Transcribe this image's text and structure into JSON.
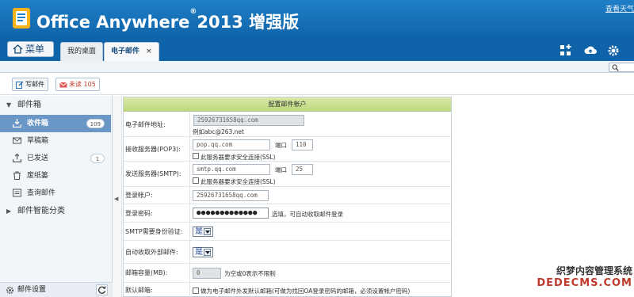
{
  "header": {
    "brand": "Office Anywhere",
    "registered": "®",
    "version": "2013 增强版",
    "weather_link": "查看天气"
  },
  "tabbar": {
    "menu_label": "菜单",
    "tabs": [
      {
        "label": "我的桌面"
      },
      {
        "label": "电子邮件",
        "close": "×"
      }
    ]
  },
  "toolbar": {
    "compose_label": "写邮件",
    "unread_label": "未读 105"
  },
  "sidebar": {
    "mailbox_title": "邮件箱",
    "items": [
      {
        "label": "收件箱",
        "count": "109"
      },
      {
        "label": "草稿箱"
      },
      {
        "label": "已发送",
        "count": "1"
      },
      {
        "label": "废纸篓"
      },
      {
        "label": "查询邮件"
      }
    ],
    "smart_title": "邮件智能分类",
    "settings_label": "邮件设置"
  },
  "form": {
    "title": "配置邮件帐户",
    "email_label": "电子邮件地址:",
    "email_value": "25926731658qq.com",
    "email_example": "例如abc@263.net",
    "pop_label": "接收服务器(POP3):",
    "pop_value": "pop.qq.com",
    "pop_port_label": "端口",
    "pop_port_value": "110",
    "pop_ssl": "此服务器要求安全连接(SSL)",
    "smtp_label": "发送服务器(SMTP):",
    "smtp_value": "smtp.qq.com",
    "smtp_port_label": "端口",
    "smtp_port_value": "25",
    "smtp_ssl": "此服务器要求安全连接(SSL)",
    "account_label": "登录帐户:",
    "account_value": "25926731658qq.com",
    "password_label": "登录密码:",
    "password_value": "●●●●●●●●●●●●●",
    "password_hint": "选填，可自动收取邮件登录",
    "smtp_auth_label": "SMTP需要身份验证:",
    "smtp_auth_value": "是",
    "auto_fetch_label": "自动收取外部邮件:",
    "auto_fetch_value": "是",
    "capacity_label": "邮箱容量(MB):",
    "capacity_value": "0",
    "capacity_hint": "为空或0表示不限制",
    "default_label": "默认邮箱:",
    "default_hint": "做为电子邮件外发默认邮箱(可做为找回OA登录密码的邮箱，必须设置帐户密码)"
  },
  "watermark": {
    "line1": "织梦内容管理系统",
    "line2": "DEDECMS.COM"
  }
}
